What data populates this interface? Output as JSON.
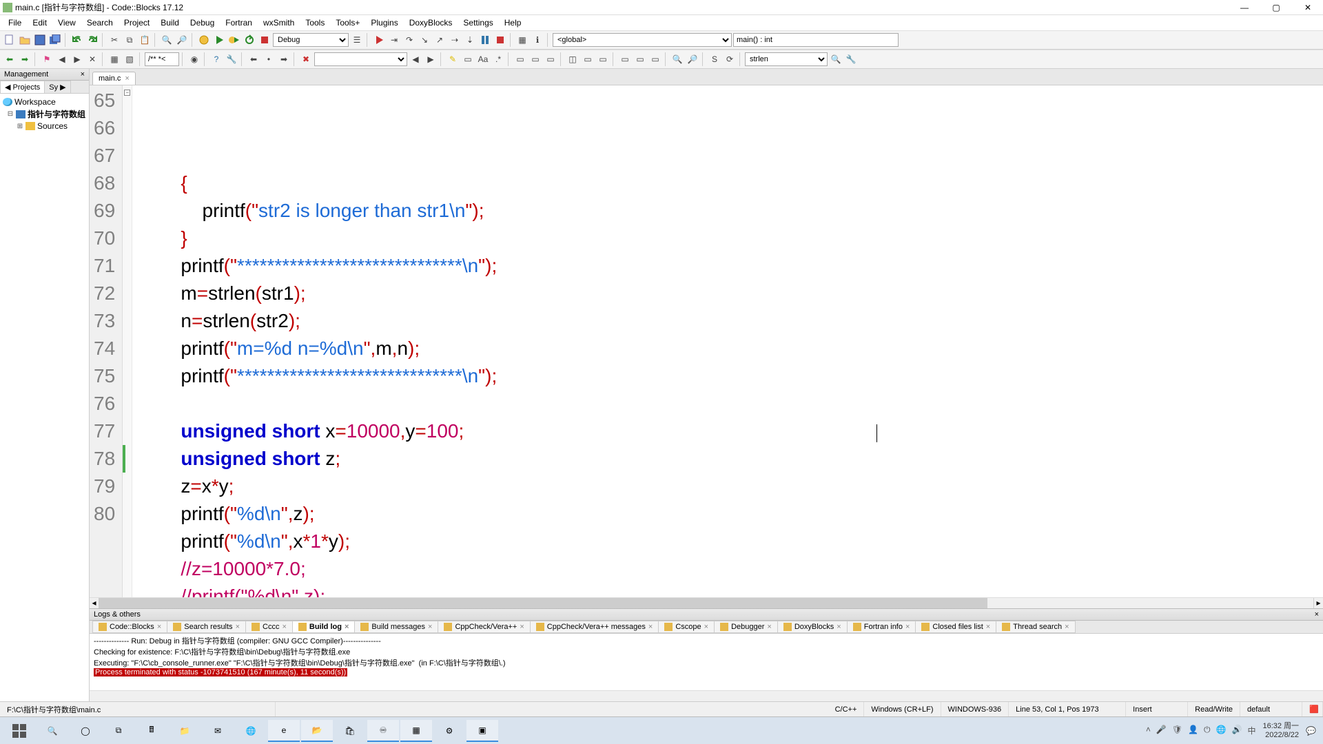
{
  "window": {
    "title": "main.c [指针与字符数组] - Code::Blocks 17.12",
    "min": "—",
    "max": "▢",
    "close": "✕"
  },
  "menus": [
    "File",
    "Edit",
    "View",
    "Search",
    "Project",
    "Build",
    "Debug",
    "Fortran",
    "wxSmith",
    "Tools",
    "Tools+",
    "Plugins",
    "DoxyBlocks",
    "Settings",
    "Help"
  ],
  "toolbar1": {
    "target": "Debug",
    "scope": "<global>",
    "func": "main() : int"
  },
  "toolbar2": {
    "doc_mode": "/**  *<",
    "search_box": "",
    "find_combo": "strlen"
  },
  "management": {
    "title": "Management",
    "tabs": [
      "Projects",
      "Sy"
    ],
    "tree": {
      "workspace": "Workspace",
      "project": "指针与字符数组",
      "folder": "Sources"
    }
  },
  "editor": {
    "tab": "main.c",
    "lines": [
      {
        "n": "65",
        "html": "        <span class='op'>{</span>"
      },
      {
        "n": "66",
        "html": "            <span class='fn'>printf</span><span class='op'>(</span><span class='op'>\"</span><span class='str'>str2 is longer than str1\\n</span><span class='op'>\"</span><span class='op'>);</span>"
      },
      {
        "n": "67",
        "html": "        <span class='op'>}</span>"
      },
      {
        "n": "68",
        "html": "        <span class='fn'>printf</span><span class='op'>(</span><span class='op'>\"</span><span class='str'>******************************\\n</span><span class='op'>\"</span><span class='op'>);</span>"
      },
      {
        "n": "69",
        "html": "        m<span class='op'>=</span>strlen<span class='op'>(</span>str1<span class='op'>);</span>"
      },
      {
        "n": "70",
        "html": "        n<span class='op'>=</span>strlen<span class='op'>(</span>str2<span class='op'>);</span>"
      },
      {
        "n": "71",
        "html": "        <span class='fn'>printf</span><span class='op'>(</span><span class='op'>\"</span><span class='str'>m=%d n=%d\\n</span><span class='op'>\"</span><span class='op'>,</span>m<span class='op'>,</span>n<span class='op'>);</span>"
      },
      {
        "n": "72",
        "html": "        <span class='fn'>printf</span><span class='op'>(</span><span class='op'>\"</span><span class='str'>******************************\\n</span><span class='op'>\"</span><span class='op'>);</span>"
      },
      {
        "n": "73",
        "html": ""
      },
      {
        "n": "74",
        "html": "        <span class='kw'>unsigned</span> <span class='kw'>short</span> x<span class='op'>=</span><span class='num'>10000</span><span class='op'>,</span>y<span class='op'>=</span><span class='num'>100</span><span class='op'>;</span>"
      },
      {
        "n": "75",
        "html": "        <span class='kw'>unsigned</span> <span class='kw'>short</span> z<span class='op'>;</span>"
      },
      {
        "n": "76",
        "html": "        z<span class='op'>=</span>x<span class='op'>*</span>y<span class='op'>;</span>"
      },
      {
        "n": "77",
        "html": "        <span class='fn'>printf</span><span class='op'>(</span><span class='op'>\"</span><span class='str'>%d\\n</span><span class='op'>\"</span><span class='op'>,</span>z<span class='op'>);</span>"
      },
      {
        "n": "78",
        "html": "        <span class='fn'>printf</span><span class='op'>(</span><span class='op'>\"</span><span class='str'>%d\\n</span><span class='op'>\"</span><span class='op'>,</span>x<span class='op'>*</span><span class='num'>1</span><span class='op'>*</span>y<span class='op'>);</span>"
      },
      {
        "n": "79",
        "html": "        <span class='cm'>//z=10000*7.0;</span>"
      },
      {
        "n": "80",
        "html": "        <span class='cm'>//printf(\"%d\\n\",z);</span>"
      }
    ]
  },
  "logs": {
    "title": "Logs & others",
    "tabs": [
      "Code::Blocks",
      "Search results",
      "Cccc",
      "Build log",
      "Build messages",
      "CppCheck/Vera++",
      "CppCheck/Vera++ messages",
      "Cscope",
      "Debugger",
      "DoxyBlocks",
      "Fortran info",
      "Closed files list",
      "Thread search"
    ],
    "active_tab": "Build log",
    "lines": [
      "-------------- Run: Debug in 指针与字符数组 (compiler: GNU GCC Compiler)---------------",
      "",
      "Checking for existence: F:\\C\\指针与字符数组\\bin\\Debug\\指针与字符数组.exe",
      "Executing: \"F:\\C\\cb_console_runner.exe\" \"F:\\C\\指针与字符数组\\bin\\Debug\\指针与字符数组.exe\"  (in F:\\C\\指针与字符数组\\.)"
    ],
    "term": "Process terminated with status -1073741510 (167 minute(s), 11 second(s))"
  },
  "status": {
    "path": "F:\\C\\指针与字符数组\\main.c",
    "lang": "C/C++",
    "eol": "Windows (CR+LF)",
    "enc": "WINDOWS-936",
    "pos": "Line 53, Col 1, Pos 1973",
    "ins": "Insert",
    "rw": "Read/Write",
    "prof": "default"
  },
  "tray": {
    "time": "16:32 周一",
    "date": "2022/8/22"
  }
}
